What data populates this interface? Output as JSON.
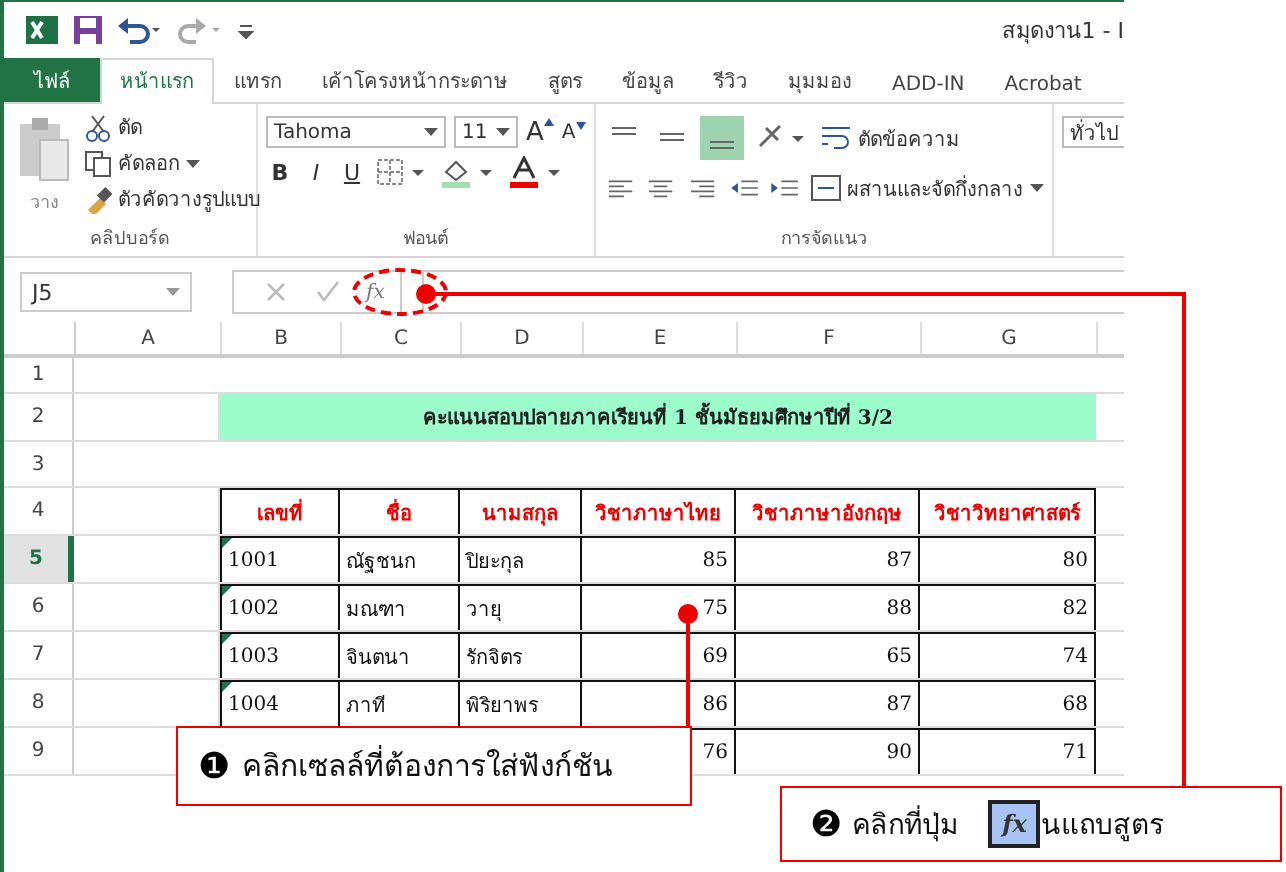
{
  "title_bar": {
    "title": "สมุดงาน1 - I"
  },
  "tabs": [
    {
      "label": "ไฟล์",
      "kind": "file",
      "selected": false
    },
    {
      "label": "หน้าแรก",
      "kind": "tab",
      "selected": true
    },
    {
      "label": "แทรก",
      "kind": "tab",
      "selected": false
    },
    {
      "label": "เค้าโครงหน้ากระดาษ",
      "kind": "tab",
      "selected": false
    },
    {
      "label": "สูตร",
      "kind": "tab",
      "selected": false
    },
    {
      "label": "ข้อมูล",
      "kind": "tab",
      "selected": false
    },
    {
      "label": "รีวิว",
      "kind": "tab",
      "selected": false
    },
    {
      "label": "มุมมอง",
      "kind": "tab",
      "selected": false
    },
    {
      "label": "ADD-IN",
      "kind": "tab",
      "selected": false
    },
    {
      "label": "Acrobat",
      "kind": "tab",
      "selected": false
    }
  ],
  "ribbon": {
    "clipboard": {
      "paste": "วาง",
      "cut": "ตัด",
      "copy": "คัดลอก",
      "format_painter": "ตัวคัดวางรูปแบบ",
      "label": "คลิปบอร์ด"
    },
    "font": {
      "font_name": "Tahoma",
      "font_size": "11",
      "grow_font": "A",
      "shrink_font": "A",
      "bold": "B",
      "italic": "I",
      "underline": "U",
      "label": "ฟอนต์"
    },
    "alignment": {
      "wrap_text": "ตัดข้อความ",
      "merge_center": "ผสานและจัดกึ่งกลาง",
      "label": "การจัดแนว"
    },
    "number": {
      "format": "ทั่วไป"
    }
  },
  "formula_bar": {
    "name_box": "J5",
    "function_button": "fx"
  },
  "sheet": {
    "columns": [
      "A",
      "B",
      "C",
      "D",
      "E",
      "F",
      "G"
    ],
    "top_rows": [
      "1",
      "2",
      "3",
      "4"
    ],
    "title": "คะแนนสอบปลายภาคเรียนที่ 1 ชั้นมัธยมศึกษาปีที่ 3/2",
    "headers": [
      "เลขที่",
      "ชื่อ",
      "นามสกุล",
      "วิชาภาษาไทย",
      "วิชาภาษาอังกฤษ",
      "วิชาวิทยาศาสตร์"
    ],
    "rows": [
      {
        "number": "5",
        "selected": true,
        "cells": [
          null,
          "1001",
          "ณัฐชนก",
          "ปิยะกุล",
          "85",
          "87",
          "80"
        ]
      },
      {
        "number": "6",
        "selected": false,
        "cells": [
          null,
          "1002",
          "มณฑา",
          "วายุ",
          "75",
          "88",
          "82"
        ]
      },
      {
        "number": "7",
        "selected": false,
        "cells": [
          null,
          "1003",
          "จินตนา",
          "รักจิตร",
          "69",
          "65",
          "74"
        ]
      },
      {
        "number": "8",
        "selected": false,
        "cells": [
          null,
          "1004",
          "ภาที",
          "พิริยาพร",
          "86",
          "87",
          "68"
        ]
      },
      {
        "number": "9",
        "selected": false,
        "cells": [
          null,
          null,
          null,
          null,
          "76",
          "90",
          "71"
        ]
      }
    ]
  },
  "callouts": [
    {
      "marker": "❶",
      "text": "คลิกเซลล์ที่ต้องการใส่ฟังก์ชัน"
    },
    {
      "marker": "❷",
      "text": "คลิกที่ปุ่ม",
      "button": "fx",
      "text_after": "นแถบสูตร"
    }
  ]
}
